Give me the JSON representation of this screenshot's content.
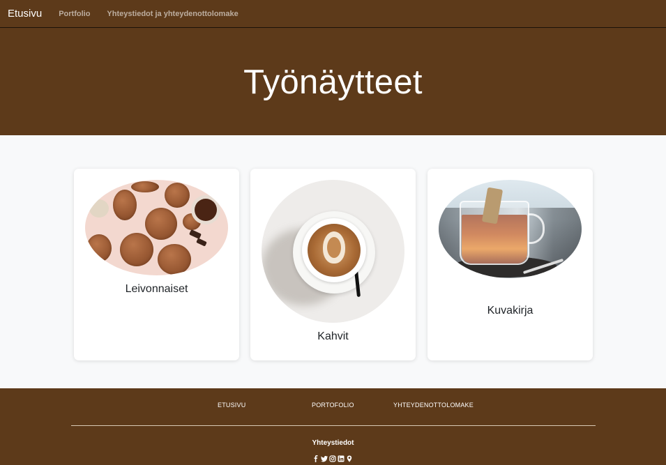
{
  "navbar": {
    "brand": "Etusivu",
    "links": [
      "Portfolio",
      "Yhteystiedot ja yhteydenottolomake"
    ]
  },
  "hero": {
    "title": "Työnäytteet"
  },
  "cards": [
    {
      "title": "Leivonnaiset",
      "image": "cookies-photo"
    },
    {
      "title": "Kahvit",
      "image": "latte-photo"
    },
    {
      "title": "Kuvakirja",
      "image": "tea-glass-photo"
    }
  ],
  "footer": {
    "links": [
      "ETUSIVU",
      "PORTOFOLIO",
      "YHTEYDENOTTOLOMAKE"
    ],
    "contact_title": "Yhteystiedot",
    "social_icons": [
      "facebook-icon",
      "twitter-icon",
      "instagram-icon",
      "linkedin-icon",
      "location-pin-icon"
    ]
  },
  "colors": {
    "brand_brown": "#5d3a1a",
    "page_background": "#f8f9fa",
    "card_background": "#ffffff"
  }
}
